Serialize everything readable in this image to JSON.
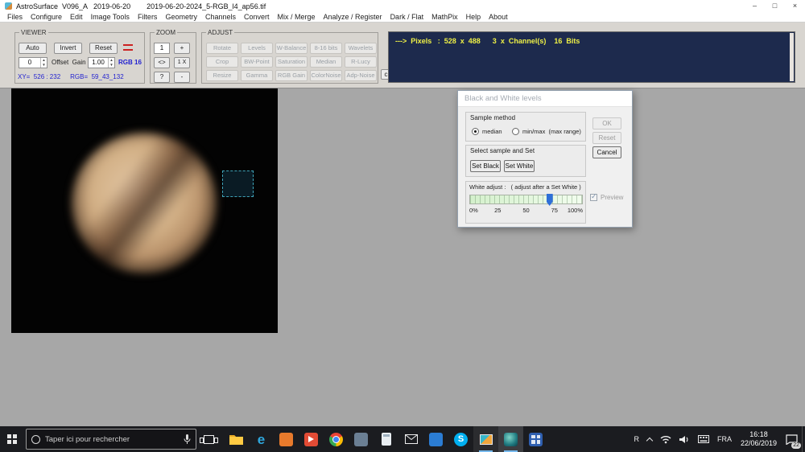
{
  "window": {
    "app_title": "AstroSurface  V096_A   2019-06-20",
    "file_title": "2019-06-20-2024_5-RGB_l4_ap56.tif",
    "controls": {
      "minimize": "–",
      "maximize": "□",
      "close": "×"
    }
  },
  "menu": {
    "items": [
      "Files",
      "Configure",
      "Edit",
      "Image Tools",
      "Filters",
      "Geometry",
      "Channels",
      "Convert",
      "Mix / Merge",
      "Analyze / Register",
      "Dark / Flat",
      "MathPix",
      "Help",
      "About"
    ]
  },
  "toolbar": {
    "viewer": {
      "label": "VIEWER",
      "auto": "Auto",
      "invert": "Invert",
      "reset": "Reset",
      "offset_value": "0",
      "offset_gain_label": "Offset  Gain",
      "gain_value": "1.00",
      "rgb_mode": "RGB 16",
      "xy_status": "XY=  526 : 232",
      "rgb_status": "RGB=  59_43_132"
    },
    "zoom": {
      "label": "ZOOM",
      "level": "1",
      "zoom_in": "+",
      "fit": "<>",
      "one_x": "1 X",
      "help": "?",
      "zoom_out": "-"
    },
    "adjust": {
      "label": "ADJUST",
      "buttons": [
        "Rotate",
        "Levels",
        "W-Balance",
        "8-16 bits",
        "Wavelets",
        "Crop",
        "BW-Point",
        "Saturation",
        "Median",
        "R-Lucy",
        "Resize",
        "Gamma",
        "RGB Gain",
        "ColorNoise",
        "Adp-Noise"
      ],
      "c_button": "c"
    },
    "info": "--->  Pixels   :  528  x  488      3  x  Channel(s)    16  Bits"
  },
  "dialog": {
    "title": "Black and White levels",
    "sample_method_label": "Sample method",
    "radio_median": "median",
    "radio_minmax": "min/max  (max range)",
    "select_sample_label": "Select sample and Set",
    "set_black": "Set Black",
    "set_white": "Set White",
    "white_adjust_label": "White adjust :   ( adjust after a Set White )",
    "ticks": [
      "0%",
      "25",
      "50",
      "75",
      "100%"
    ],
    "slider_percent": 71,
    "ok": "OK",
    "reset": "Reset",
    "cancel": "Cancel",
    "preview": "Preview"
  },
  "taskbar": {
    "search_placeholder": "Taper ici pour rechercher",
    "language": "FRA",
    "time": "16:18",
    "date": "22/06/2019",
    "notification_badge": "22"
  },
  "icons": {
    "edge_glyph": "e",
    "skype_glyph": "S",
    "check_glyph": "✓",
    "tray_r_glyph": "R"
  },
  "colors": {
    "info_panel_bg": "#1d2a4d",
    "info_panel_text": "#eef046",
    "status_text_blue": "#1f1fd0",
    "selection_teal": "#3fa3b8",
    "slider_thumb_blue": "#2f6fd8",
    "taskbar_bg": "#1b1c20"
  }
}
